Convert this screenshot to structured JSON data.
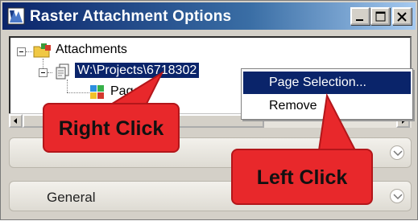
{
  "window": {
    "title": "Raster Attachment Options",
    "buttons": [
      {
        "name": "minimize-button",
        "icon": "minimize-icon"
      },
      {
        "name": "maximize-button",
        "icon": "maximize-icon"
      },
      {
        "name": "close-button",
        "icon": "close-icon"
      }
    ]
  },
  "tree": {
    "root_label": "Attachments",
    "attachment_label": "W:\\Projects\\6718302",
    "page_label": "Page 1"
  },
  "context_menu": {
    "items": [
      "Page Selection...",
      "Remove"
    ]
  },
  "sections": [
    {
      "label": ""
    },
    {
      "label": "General"
    }
  ],
  "callouts": {
    "right": "Right Click",
    "left": "Left Click"
  },
  "colors": {
    "selection": "#0a246a",
    "callout": "#e8282b"
  }
}
